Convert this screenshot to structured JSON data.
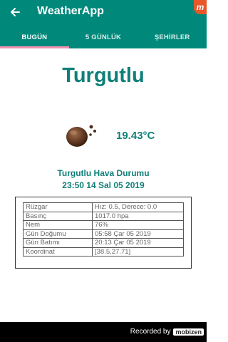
{
  "appbar": {
    "title": "WeatherApp",
    "back_icon": "arrow-back-icon",
    "corner_logo": "m",
    "color": "#00897b"
  },
  "tabs": [
    {
      "label": "BUGÜN",
      "active": true
    },
    {
      "label": "5 GÜNLÜK",
      "active": false
    },
    {
      "label": "ŞEHİRLER",
      "active": false
    }
  ],
  "weather": {
    "city": "Turgutlu",
    "icon": "cloudy-night-icon",
    "temperature": "19.43°C",
    "heading": "Turgutlu Hava Durumu",
    "datetime": "23:50 14 Sal 05 2019"
  },
  "details": [
    {
      "key": "Rüzgar",
      "value": "Hız: 0.5, Derece: 0.0"
    },
    {
      "key": "Basınç",
      "value": "1017.0 hpa"
    },
    {
      "key": "Nem",
      "value": "76%"
    },
    {
      "key": "Gün Doğumu",
      "value": "05:58 Çar 05 2019"
    },
    {
      "key": "Gün Batımı",
      "value": "20:13 Çar 05 2019"
    },
    {
      "key": "Koordinat",
      "value": "[38.5,27.71]"
    }
  ],
  "recording": {
    "label": "Recorded by",
    "brand": "mobizen"
  },
  "colors": {
    "accent": "#0f7f78",
    "tab_indicator": "#f48fb1"
  }
}
